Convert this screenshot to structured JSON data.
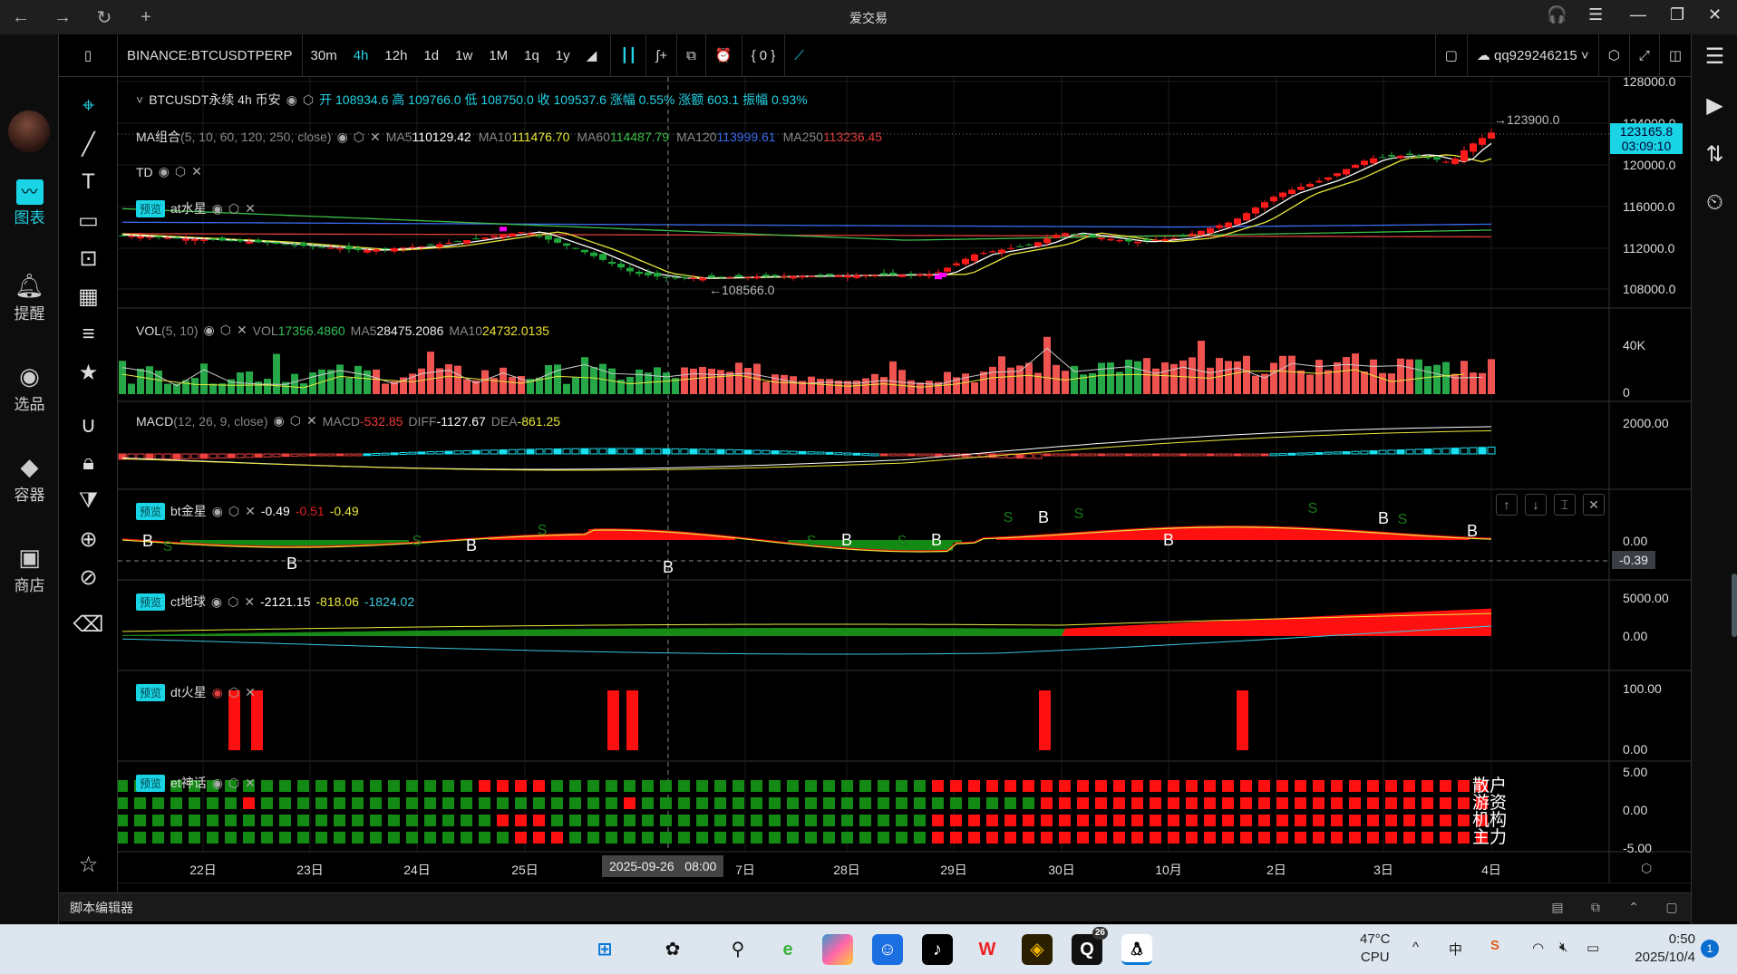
{
  "window": {
    "title": "爱交易",
    "back": "←",
    "forward": "→",
    "reload": "↻",
    "new_tab": "+"
  },
  "leftbar": {
    "items": [
      {
        "label": "图表",
        "icon": "chart-icon"
      },
      {
        "label": "提醒",
        "icon": "bell-icon"
      },
      {
        "label": "选品",
        "icon": "search-chart-icon"
      },
      {
        "label": "容器",
        "icon": "container-icon"
      },
      {
        "label": "商店",
        "icon": "bag-icon"
      }
    ]
  },
  "toolbar": {
    "symbol": "BINANCE:BTCUSDTPERP",
    "timeframes": [
      "30m",
      "4h",
      "12h",
      "1d",
      "1w",
      "1M",
      "1q",
      "1y"
    ],
    "selected": "4h",
    "indicator_count": "{ 0 }",
    "user": "qq929246215"
  },
  "main": {
    "title": "BTCUSDT永续 4h 币安",
    "ohlc": "开 108934.6 高 109766.0 低 108750.0 收 109537.6 涨幅 0.55% 涨额 603.1 振幅 0.93%",
    "ma_label": "MA组合",
    "ma_params": "(5, 10, 60, 120, 250, close)",
    "ma": [
      {
        "k": "MA5",
        "v": "110129.42",
        "c": "#ffffff"
      },
      {
        "k": "MA10",
        "v": "111476.70",
        "c": "#e8e83a"
      },
      {
        "k": "MA60",
        "v": "114487.79",
        "c": "#3cbf4a"
      },
      {
        "k": "MA120",
        "v": "113999.61",
        "c": "#3a6cf0"
      },
      {
        "k": "MA250",
        "v": "113236.45",
        "c": "#e03c3c"
      }
    ],
    "td_label": "TD",
    "at_badge": "预览",
    "at_label": "at水星",
    "high_marker": "→123900.0",
    "low_marker": "←108566.0",
    "price_axis": [
      "128000.0",
      "124000.0",
      "120000.0",
      "116000.0",
      "112000.0",
      "108000.0"
    ],
    "last_price": "123165.8",
    "countdown": "03:09:10"
  },
  "vol": {
    "label": "VOL",
    "params": "(5, 10)",
    "vol_k": "VOL",
    "vol": "17356.4860",
    "ma5_k": "MA5",
    "ma5": "28475.2086",
    "ma10_k": "MA10",
    "ma10": "24732.0135",
    "axis": [
      "40K",
      "0"
    ]
  },
  "macd": {
    "label": "MACD",
    "params": "(12, 26, 9, close)",
    "macd_k": "MACD",
    "macd": "-532.85",
    "diff_k": "DIFF",
    "diff": "-1127.67",
    "dea_k": "DEA",
    "dea": "-861.25",
    "axis": [
      "2000.00"
    ]
  },
  "bt": {
    "badge": "预览",
    "label": "bt金星",
    "v1": "-0.49",
    "v2": "-0.51",
    "v3": "-0.49",
    "axis": [
      "0.00"
    ],
    "cursor_value": "-0.39",
    "buy": "B",
    "sell": "S"
  },
  "ct": {
    "badge": "预览",
    "label": "ct地球",
    "v1": "-2121.15",
    "v2": "-818.06",
    "v3": "-1824.02",
    "axis": [
      "5000.00",
      "0.00"
    ]
  },
  "dt": {
    "badge": "预览",
    "label": "dt火星",
    "axis": [
      "100.00",
      "0.00"
    ]
  },
  "et": {
    "badge": "预览",
    "label": "et神话",
    "axis": [
      "5.00",
      "0.00",
      "-5.00"
    ],
    "rows": [
      "散户",
      "游资",
      "机构",
      "主力"
    ]
  },
  "time_axis": [
    "22日",
    "23日",
    "24日",
    "25日",
    "7日",
    "28日",
    "29日",
    "30日",
    "10月",
    "2日",
    "3日",
    "4日"
  ],
  "crosshair": {
    "date": "2025-09-26",
    "time": "08:00"
  },
  "editor": {
    "label": "脚本编辑器"
  },
  "taskbar": {
    "temp": "47°C",
    "cpu": "CPU",
    "ime": "中",
    "time": "0:50",
    "date": "2025/10/4",
    "badge": "26",
    "notif": "1"
  },
  "colors": {
    "up": "#ff1a1a",
    "down": "#1fa83a",
    "accent": "#18d4e4"
  }
}
